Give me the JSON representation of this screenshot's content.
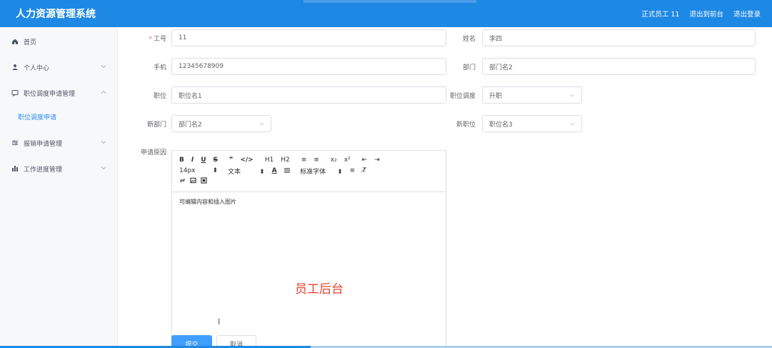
{
  "header": {
    "app_title": "人力资源管理系统",
    "user_label": "正式员工 11",
    "back_label": "退出到前台",
    "logout_label": "退出登录"
  },
  "sidebar": {
    "items": [
      {
        "label": "首页",
        "icon": "home-icon"
      },
      {
        "label": "个人中心",
        "icon": "user-icon"
      },
      {
        "label": "职位调度申请管理",
        "icon": "message-icon",
        "expanded": true,
        "children": [
          "职位调度申请"
        ]
      },
      {
        "label": "报销申请管理",
        "icon": "sliders-icon"
      },
      {
        "label": "工作进度管理",
        "icon": "bar-chart-icon"
      }
    ]
  },
  "form": {
    "employee_no": {
      "label": "工号",
      "required": true,
      "value": "11"
    },
    "name": {
      "label": "姓名",
      "value": "李四"
    },
    "phone": {
      "label": "手机",
      "value": "12345678909"
    },
    "department": {
      "label": "部门",
      "value": "部门名2"
    },
    "position": {
      "label": "职位",
      "value": "职位名1"
    },
    "transfer_type": {
      "label": "职位调度",
      "value": "升职"
    },
    "new_department": {
      "label": "新部门",
      "value": "部门名2"
    },
    "new_position": {
      "label": "新职位",
      "value": "职位名3"
    },
    "reason": {
      "label": "申请原因",
      "content": "可编辑内容和插入图片"
    }
  },
  "editor": {
    "toolbar_row1": [
      "B",
      "I",
      "U",
      "S",
      "❞",
      "</>",
      "H1",
      "H2",
      "≡",
      "≡",
      "x₂",
      "x²",
      "⇤",
      "⇥"
    ],
    "font_size": "14px",
    "block_type": "文本",
    "font_family": "标准字体"
  },
  "watermark": "员工后台",
  "buttons": {
    "submit": "提交",
    "cancel": "取消"
  },
  "colors": {
    "header": "#1e88e5",
    "primary": "#409eff",
    "required": "#f56c6c",
    "watermark": "#e5432f"
  }
}
